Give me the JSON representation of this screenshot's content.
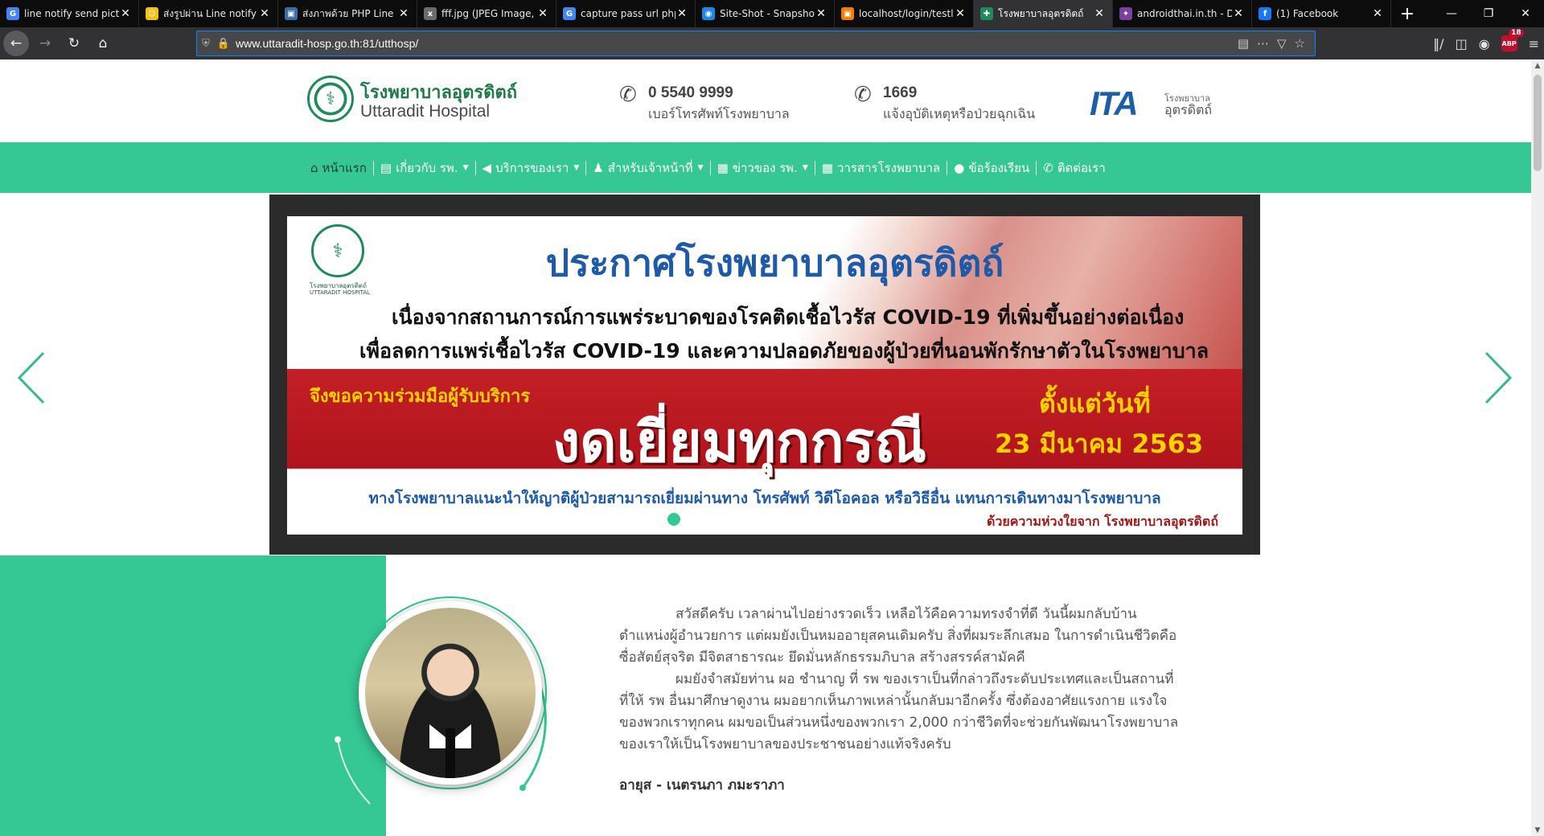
{
  "tabs": [
    {
      "title": "line notify send pictu",
      "icon": "google-icon",
      "color": "#4285f4",
      "glyph": "G"
    },
    {
      "title": "ส่งรูปผ่าน Line notify",
      "icon": "emoji-icon",
      "color": "#f4c20d",
      "glyph": "☺"
    },
    {
      "title": "ส่งภาพด้วย PHP Line",
      "icon": "page-icon",
      "color": "#3a6ea5",
      "glyph": "▣"
    },
    {
      "title": "fff.jpg (JPEG Image,",
      "icon": "image-icon",
      "color": "#6b6b6b",
      "glyph": "x"
    },
    {
      "title": "capture pass url php",
      "icon": "google-icon",
      "color": "#4285f4",
      "glyph": "G"
    },
    {
      "title": "Site-Shot - Snapshot",
      "icon": "camera-icon",
      "color": "#1e88e5",
      "glyph": "◉"
    },
    {
      "title": "localhost/login/testl",
      "icon": "page-icon",
      "color": "#f57c00",
      "glyph": "▣"
    },
    {
      "title": "โรงพยาบาลอุตรดิตถ์",
      "icon": "hospital-icon",
      "color": "#1f8a5a",
      "glyph": "✚"
    },
    {
      "title": "androidthai.in.th - D",
      "icon": "site-icon",
      "color": "#7b3fa0",
      "glyph": "✦"
    },
    {
      "title": "(1) Facebook",
      "icon": "facebook-icon",
      "color": "#1877f2",
      "glyph": "f"
    }
  ],
  "active_tab": 7,
  "browser": {
    "url": "www.uttaradit-hosp.go.th:81/utthosp/",
    "abp_count": "18",
    "abp_label": "ABP"
  },
  "site": {
    "name_th": "โรงพยาบาลอุตรดิตถ์",
    "name_en": "Uttaradit Hospital",
    "phone1_number": "0 5540 9999",
    "phone1_desc": "เบอร์โทรศัพท์โรงพยาบาล",
    "phone2_number": "1669",
    "phone2_desc": "แจ้งอุบัติเหตุหรือป่วยฉุกเฉิน",
    "ita_logo": "ITA",
    "ita_sub1": "โรงพยาบาล",
    "ita_sub2": "อุตรดิตถ์"
  },
  "menu": [
    {
      "label": "หน้าแรก",
      "icon": "home-icon",
      "glyph": "⌂",
      "dropdown": false
    },
    {
      "label": "เกี่ยวกับ รพ.",
      "icon": "building-icon",
      "glyph": "▤",
      "dropdown": true
    },
    {
      "label": "บริการของเรา",
      "icon": "megaphone-icon",
      "glyph": "◀",
      "dropdown": true
    },
    {
      "label": "สำหรับเจ้าหน้าที่",
      "icon": "user-icon",
      "glyph": "♟",
      "dropdown": true
    },
    {
      "label": "ข่าวของ รพ.",
      "icon": "newspaper-icon",
      "glyph": "▦",
      "dropdown": true
    },
    {
      "label": "วารสารโรงพยาบาล",
      "icon": "journal-icon",
      "glyph": "▦",
      "dropdown": false
    },
    {
      "label": "ข้อร้องเรียน",
      "icon": "comment-icon",
      "glyph": "●",
      "dropdown": false
    },
    {
      "label": "ติดต่อเรา",
      "icon": "phone-icon",
      "glyph": "✆",
      "dropdown": false
    }
  ],
  "banner": {
    "logo_t1": "โรงพยาบาลอุตรดิตถ์",
    "logo_t2": "UTTARADIT HOSPITAL",
    "title": "ประกาศโรงพยาบาลอุตรดิตถ์",
    "line1": "เนื่องจากสถานการณ์การแพร่ระบาดของโรคติดเชื้อไวรัส COVID-19 ที่เพิ่มขึ้นอย่างต่อเนื่อง",
    "line2": "เพื่อลดการแพร่เชื้อไวรัส COVID-19 และความปลอดภัยของผู้ป่วยที่นอนพักรักษาตัวในโรงพยาบาล",
    "ask": "จึงขอความร่วมมือผู้รับบริการ",
    "big": "งดเยี่ยมทุกกรณี",
    "since": "ตั้งแต่วันที่",
    "date": "23 มีนาคม 2563",
    "reco": "ทางโรงพยาบาลแนะนำให้ญาติผู้ป่วยสามารถเยี่ยมผ่านทาง โทรศัพท์ วิดีโอคอล หรือวิธีอื่น แทนการเดินทางมาโรงพยาบาล",
    "care": "ด้วยความห่วงใยจาก โรงพยาบาลอุตรดิตถ์",
    "slide_count": 10,
    "active_slide": 0
  },
  "director": {
    "p1": "สวัสดีครับ เวลาผ่านไปอย่างรวดเร็ว เหลือไว้คือความทรงจำที่ดี วันนี้ผมกลับบ้าน ตำแหน่งผู้อำนวยการ แต่ผมยังเป็นหมออายุสคนเดิมครับ สิ่งที่ผมระลึกเสมอ ในการดำเนินชีวิตคือ ซื่อสัตย์สุจริต มีจิตสาธารณะ ยึดมั่นหลักธรรมภิบาล สร้างสรรค์สามัคคี",
    "p2": "ผมยังจำสมัยท่าน ผอ ชำนาญ ที่ รพ ของเราเป็นที่กล่าวถึงระดับประเทศและเป็นสถานที่ที่ให้ รพ อื่นมาศึกษาดูงาน ผมอยากเห็นภาพเหล่านั้นกลับมาอีกครั้ง ซึ่งต้องอาศัยแรงกาย แรงใจของพวกเราทุกคน ผมขอเป็นส่วนหนึ่งของพวกเรา 2,000 กว่าชีวิตที่จะช่วยกันพัฒนาโรงพยาบาลของเราให้เป็นโรงพยาบาลของประชาชนอย่างแท้จริงครับ",
    "signature": "อายุส - เนตรนภา ภมะราภา"
  },
  "colors": {
    "menu_green": "#35c895",
    "brand_green": "#1f7a4a",
    "url_focus": "#0a84ff"
  }
}
